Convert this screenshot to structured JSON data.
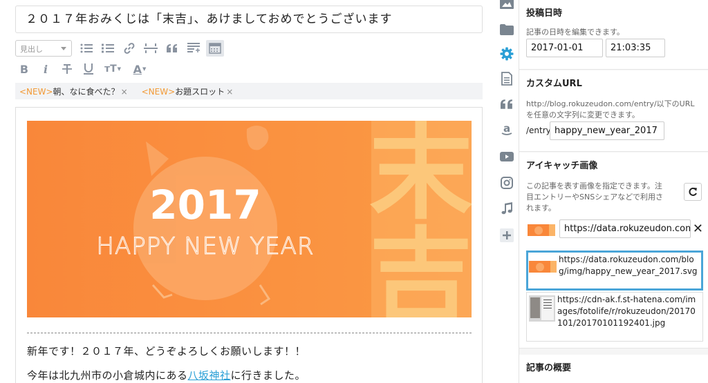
{
  "editor": {
    "title": "２０１７年おみくじは「末吉」、あけましておめでとうございます",
    "heading_select": "見出し",
    "tags": [
      {
        "new": "<NEW>",
        "label": "朝、なに食べた？",
        "remove": "×"
      },
      {
        "new": "<NEW>",
        "label": "お題スロット",
        "remove": "×"
      }
    ],
    "formatting": {
      "bold": "B",
      "italic": "i",
      "font_size": "тT",
      "color": "A"
    },
    "hero": {
      "year": "2017",
      "greeting": "HAPPY NEW YEAR",
      "fortune_char_1": "末",
      "fortune_char_2": "吉",
      "bg_color": "#f9873a",
      "accent_color": "#fcc77a"
    },
    "body": {
      "line1": "新年です！２０１７年、どうぞよろしくお願いします！！",
      "line2_before": "今年は北九州市の小倉城内にある",
      "line2_link": "八坂神社",
      "line2_after": "に行きました。"
    }
  },
  "rail_icons": [
    "photo-icon",
    "folder-icon",
    "gear-icon",
    "document-icon",
    "quote-icon",
    "amazon-icon",
    "youtube-icon",
    "instagram-icon",
    "music-icon",
    "plus-icon"
  ],
  "sidebar": {
    "post_date": {
      "title": "投稿日時",
      "desc": "記事の日時を編集できます。",
      "date": "2017-01-01",
      "time": "21:03:35"
    },
    "custom_url": {
      "title": "カスタムURL",
      "desc": "http://blog.rokuzeudon.com/entry/以下のURLを任意の文字列に変更できます。",
      "prefix": "/entry/",
      "value": "happy_new_year_2017"
    },
    "eyecatch": {
      "title": "アイキャッチ画像",
      "desc": "この記事を表す画像を指定できます。注目エントリーやSNSシェアなどで利用されます。",
      "url_value": "https://data.rokuzeudon.com/b",
      "remove": "✕",
      "candidates": [
        {
          "url": "https://data.rokuzeudon.com/blog/img/happy_new_year_2017.svg"
        },
        {
          "url": "https://cdn-ak.f.st-hatena.com/images/fotolife/r/rokuzeudon/20170101/20170101192401.jpg"
        }
      ]
    },
    "summary": {
      "title": "記事の概要"
    }
  },
  "colors": {
    "accent": "#2a9fd6",
    "rail_icon": "#7a8590",
    "rail_icon_active": "#2a9fd6",
    "tag_new": "#f29a36"
  }
}
